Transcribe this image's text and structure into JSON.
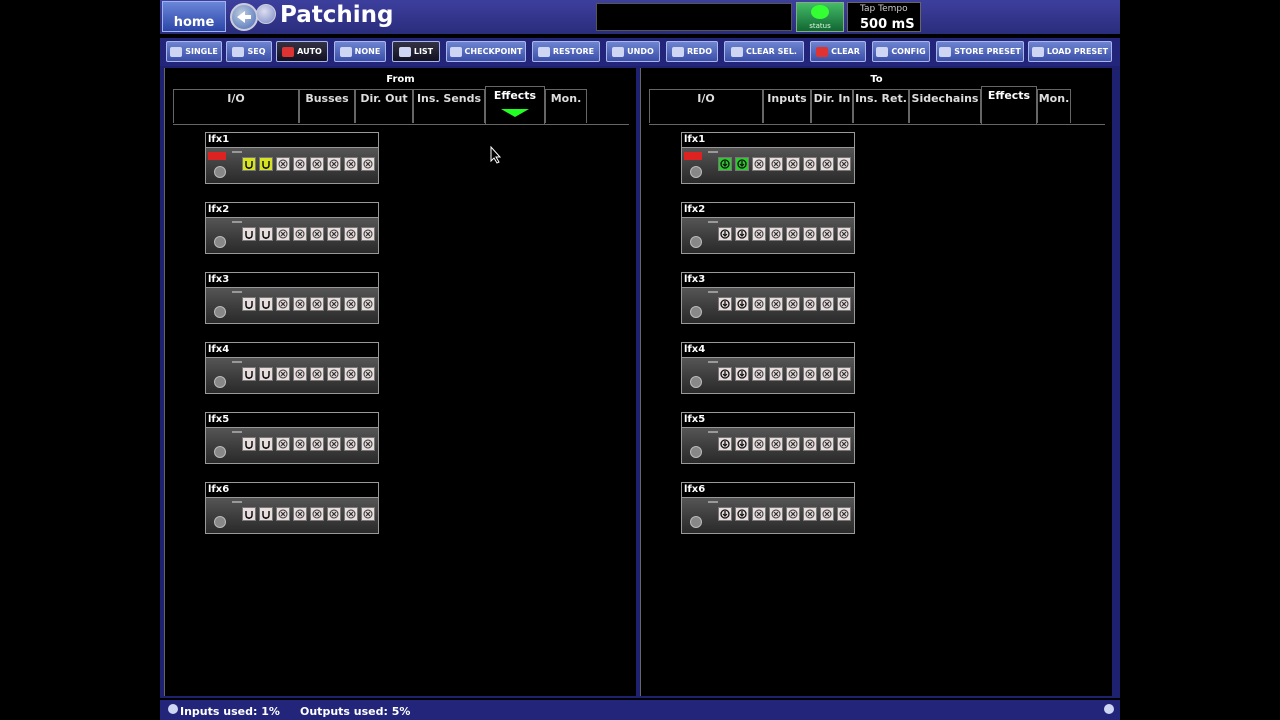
{
  "header": {
    "home_label": "home",
    "title": "Patching",
    "status_label": "status",
    "tap_tempo_label": "Tap Tempo",
    "tap_tempo_value": "500 mS"
  },
  "toolbar": {
    "single": "SINGLE",
    "seq": "SEQ",
    "auto": "AUTO",
    "none": "NONE",
    "list": "LIST",
    "checkpoint": "CHECKPOINT",
    "restore": "RESTORE",
    "undo": "UNDO",
    "redo": "REDO",
    "clear_sel": "CLEAR SEL.",
    "clear": "CLEAR",
    "config": "CONFIG",
    "store_preset": "STORE PRESET",
    "load_preset": "LOAD PRESET"
  },
  "from_panel": {
    "heading": "From",
    "tabs": [
      "I/O",
      "Busses",
      "Dir. Out",
      "Ins. Sends",
      "Effects",
      "Mon."
    ],
    "active_tab": "Effects",
    "effects": [
      {
        "name": "lfx1"
      },
      {
        "name": "lfx2"
      },
      {
        "name": "lfx3"
      },
      {
        "name": "lfx4"
      },
      {
        "name": "lfx5"
      },
      {
        "name": "lfx6"
      }
    ]
  },
  "to_panel": {
    "heading": "To",
    "tabs": [
      "I/O",
      "Inputs",
      "Dir. In",
      "Ins. Ret.",
      "Sidechains",
      "Effects",
      "Mon."
    ],
    "active_tab": "Effects",
    "effects": [
      {
        "name": "lfx1"
      },
      {
        "name": "lfx2"
      },
      {
        "name": "lfx3"
      },
      {
        "name": "lfx4"
      },
      {
        "name": "lfx5"
      },
      {
        "name": "lfx6"
      }
    ]
  },
  "colors": {
    "selected_source_port": "#d7e320",
    "selected_dest_port": "#2fc82f",
    "active_tab_marker": "#22ff22"
  },
  "statusbar": {
    "inputs_used": "Inputs used: 1%",
    "outputs_used": "Outputs used: 5%"
  }
}
